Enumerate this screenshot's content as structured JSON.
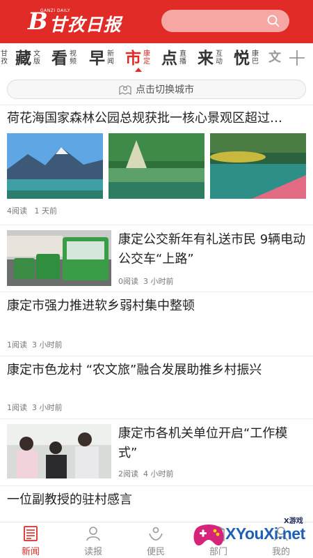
{
  "header": {
    "logo_mark": "B",
    "logo_text": "甘孜日报",
    "logo_sub": "GANZI DAILY",
    "brand_color": "#e02b27"
  },
  "search": {
    "icon": "search-icon"
  },
  "tabs": [
    {
      "big": "",
      "small": "甘孜"
    },
    {
      "big": "藏",
      "small": "文版"
    },
    {
      "big": "看",
      "small": "视频"
    },
    {
      "big": "早",
      "small": "新闻"
    },
    {
      "big": "市",
      "small": "康定"
    },
    {
      "big": "点",
      "small": "直播"
    },
    {
      "big": "来",
      "small": "互动"
    },
    {
      "big": "悦",
      "small": "康巴"
    },
    {
      "big": "文",
      "small": ""
    }
  ],
  "city_switch": {
    "label": "点击切换城市",
    "icon": "location-map-icon"
  },
  "feed": [
    {
      "title": "荷花海国家森林公园总规获批一核心景观区超过…",
      "reads": "4阅读",
      "time": "1 天前"
    },
    {
      "title": "康定公交新年有礼送市民 9辆电动公交车“上路”",
      "reads": "0阅读",
      "time": "3 小时前"
    },
    {
      "title": "康定市强力推进软乡弱村集中整顿",
      "reads": "1阅读",
      "time": "3 小时前"
    },
    {
      "title": "康定市色龙村 “农文旅”融合发展助推乡村振兴",
      "reads": "1阅读",
      "time": "3 小时前"
    },
    {
      "title": "康定市各机关单位开启“工作模式”",
      "reads": "2阅读",
      "time": "4 小时前"
    },
    {
      "title": "一位副教授的驻村感言",
      "reads": "",
      "time": ""
    }
  ],
  "bottom_nav": [
    {
      "label": "新闻",
      "icon": "newspaper-icon"
    },
    {
      "label": "读报",
      "icon": "person-icon"
    },
    {
      "label": "便民",
      "icon": "hands-icon"
    },
    {
      "label": "部门",
      "icon": "building-icon"
    },
    {
      "label": "我的",
      "icon": "user-icon"
    }
  ],
  "watermark": {
    "text": "XYouXi.net",
    "small": "X游戏"
  }
}
